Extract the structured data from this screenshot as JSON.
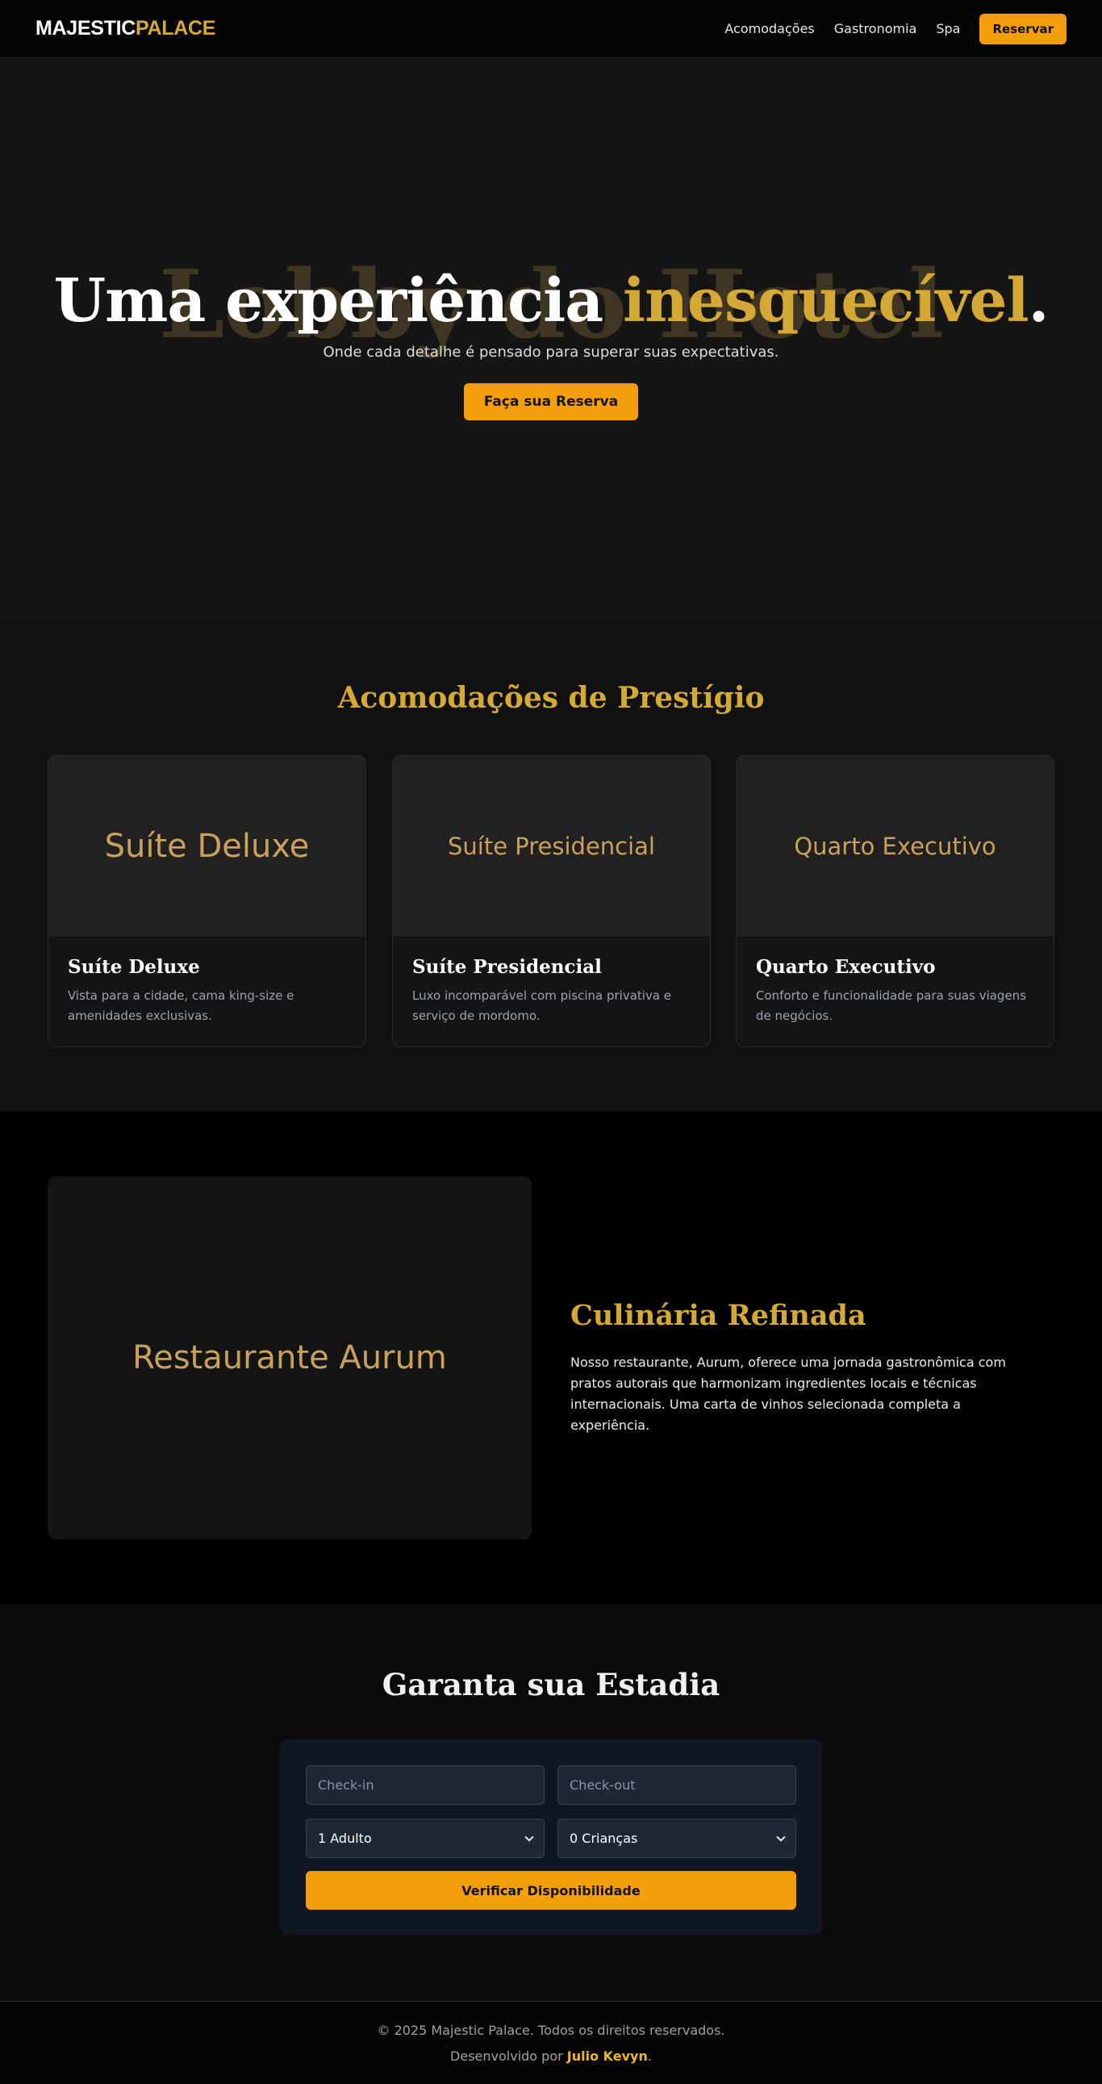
{
  "header": {
    "logo_part1": "MAJESTIC",
    "logo_part2": "PALACE",
    "nav": [
      "Acomodações",
      "Gastronomia",
      "Spa"
    ],
    "reserve_button": "Reservar"
  },
  "hero": {
    "background_text": "Lobby do Hotel",
    "title_part1": "Uma experiência ",
    "title_highlight": "inesquecível",
    "title_end": ".",
    "subtitle": "Onde cada detalhe é pensado para superar suas expectativas.",
    "cta": "Faça sua Reserva"
  },
  "accommodations": {
    "title": "Acomodações de Prestígio",
    "cards": [
      {
        "image_label": "Suíte Deluxe",
        "name": "Suíte Deluxe",
        "description": "Vista para a cidade, cama king-size e amenidades exclusivas."
      },
      {
        "image_label": "Suíte Presidencial",
        "name": "Suíte Presidencial",
        "description": "Luxo incomparável com piscina privativa e serviço de mordomo."
      },
      {
        "image_label": "Quarto Executivo",
        "name": "Quarto Executivo",
        "description": "Conforto e funcionalidade para suas viagens de negócios."
      }
    ]
  },
  "restaurant": {
    "image_label": "Restaurante Aurum",
    "title": "Culinária Refinada",
    "text": "Nosso restaurante, Aurum, oferece uma jornada gastronômica com pratos autorais que harmonizam ingredientes locais e técnicas internacionais. Uma carta de vinhos selecionada completa a experiência."
  },
  "booking": {
    "title": "Garanta sua Estadia",
    "checkin_placeholder": "Check-in",
    "checkout_placeholder": "Check-out",
    "adults_selected": "1 Adulto",
    "children_selected": "0 Crianças",
    "submit": "Verificar Disponibilidade"
  },
  "footer": {
    "copyright": "© 2025 Majestic Palace. Todos os direitos reservados.",
    "developed_by": "Desenvolvido por ",
    "developer": "Julio Kevyn",
    "period": "."
  },
  "colors": {
    "gold": "#d4a936",
    "accent": "#f59e0b",
    "background": "#0a0a0a"
  }
}
